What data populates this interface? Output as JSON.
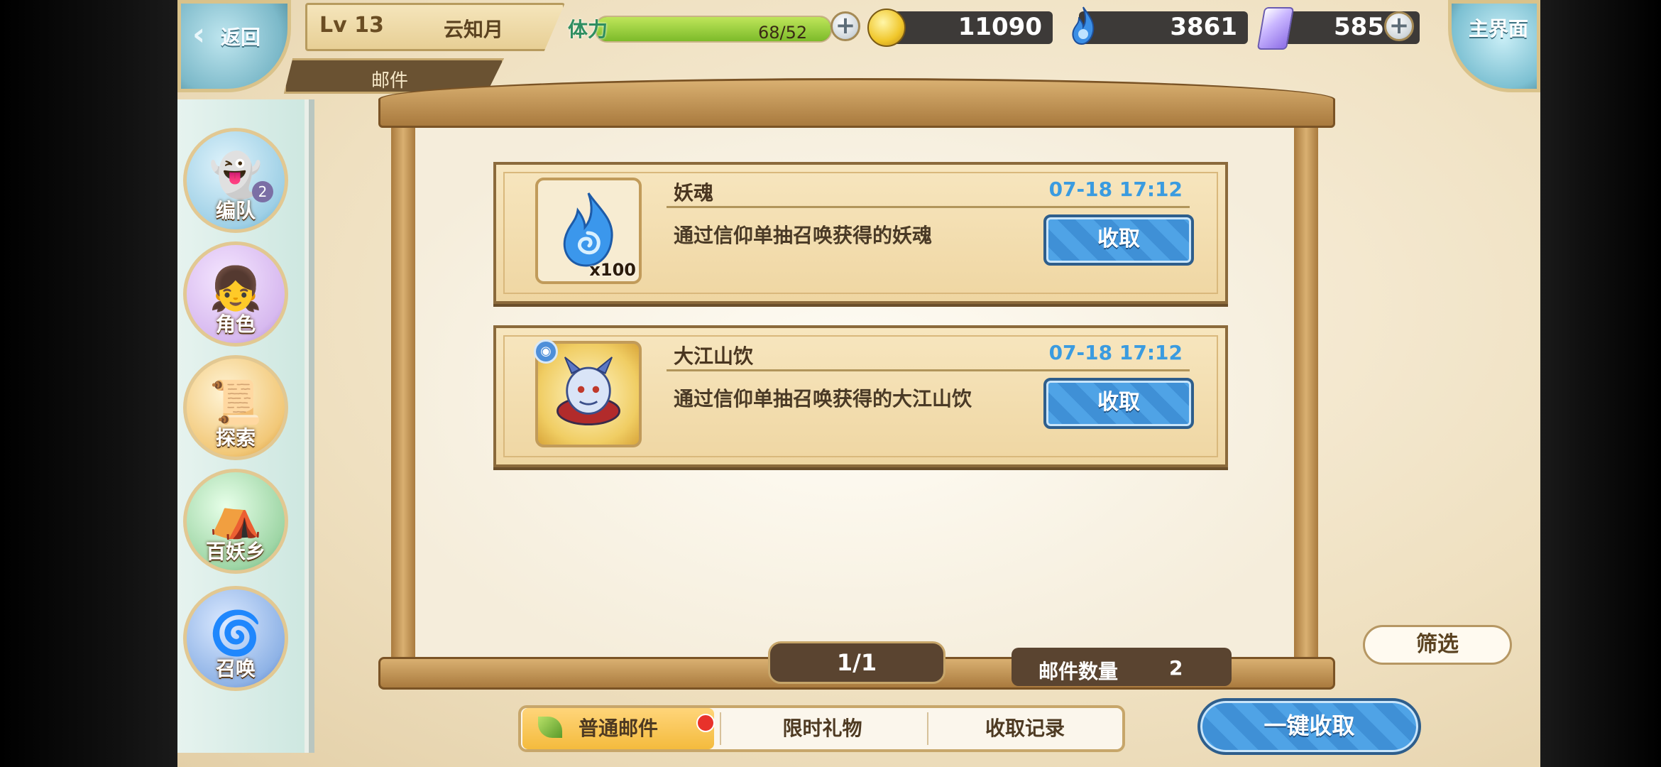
{
  "header": {
    "back_label": "返回",
    "level": "Lv 13",
    "player_name": "云知月",
    "section_tab": "邮件",
    "stamina_label": "体力",
    "stamina_value": "68/52",
    "stamina_fill": 1.0,
    "gold": "11090",
    "soul": "3861",
    "gem": "585",
    "home_label": "主界面"
  },
  "nav": [
    {
      "label": "编队",
      "badge": "2"
    },
    {
      "label": "角色"
    },
    {
      "label": "探索"
    },
    {
      "label": "百妖乡"
    },
    {
      "label": "召唤"
    }
  ],
  "mails": [
    {
      "title": "妖魂",
      "date": "07-18 17:12",
      "desc": "通过信仰单抽召唤获得的妖魂",
      "qty": "x100",
      "button": "收取"
    },
    {
      "title": "大江山饮",
      "date": "07-18 17:12",
      "desc": "通过信仰单抽召唤获得的大江山饮",
      "button": "收取"
    }
  ],
  "pager": {
    "page": "1/1",
    "count_label": "邮件数量",
    "count": "2"
  },
  "filter_label": "筛选",
  "tabs": {
    "normal": "普通邮件",
    "gift": "限时礼物",
    "history": "收取记录"
  },
  "claim_all_label": "一键收取",
  "colors": {
    "accent_blue": "#4fa3e6",
    "stamina_green": "#7cbb2a",
    "date_blue": "#3a9be0"
  }
}
